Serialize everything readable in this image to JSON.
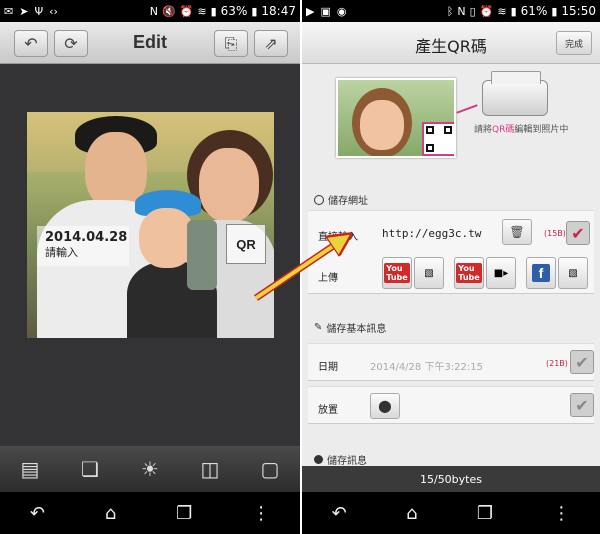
{
  "left_screen": {
    "status": {
      "battery": "63%",
      "time": "18:47"
    },
    "title": "Edit",
    "photo": {
      "date": "2014.04.28",
      "caption": "請輸入",
      "qr_text": "QR"
    },
    "nav": {
      "back": "↶",
      "home": "⌂",
      "recent": "❐",
      "menu": "⋮"
    }
  },
  "right_screen": {
    "status": {
      "battery": "61%",
      "time": "15:50"
    },
    "title": "產生QR碼",
    "done_label": "完成",
    "printer_note_a": "請將",
    "printer_note_hl": "QR碼",
    "printer_note_b": "編輯到照片中",
    "sections": {
      "save_url": "儲存網址",
      "save_basic": "儲存基本訊息",
      "save_message": "儲存訊息"
    },
    "url_card": {
      "direct_label": "直接輸入",
      "url_value": "http://egg3c.tw",
      "bytes": "(15B)",
      "upload_label": "上傳",
      "youtube": "You",
      "youtube2": "Tube",
      "facebook": "f"
    },
    "date_card": {
      "label": "日期",
      "value": "2014/4/28 下午3:22:15",
      "bytes": "(21B)"
    },
    "place_card": {
      "label": "放置"
    },
    "counter": "15/50bytes",
    "nav": {
      "back": "↶",
      "home": "⌂",
      "recent": "❐",
      "menu": "⋮"
    }
  }
}
